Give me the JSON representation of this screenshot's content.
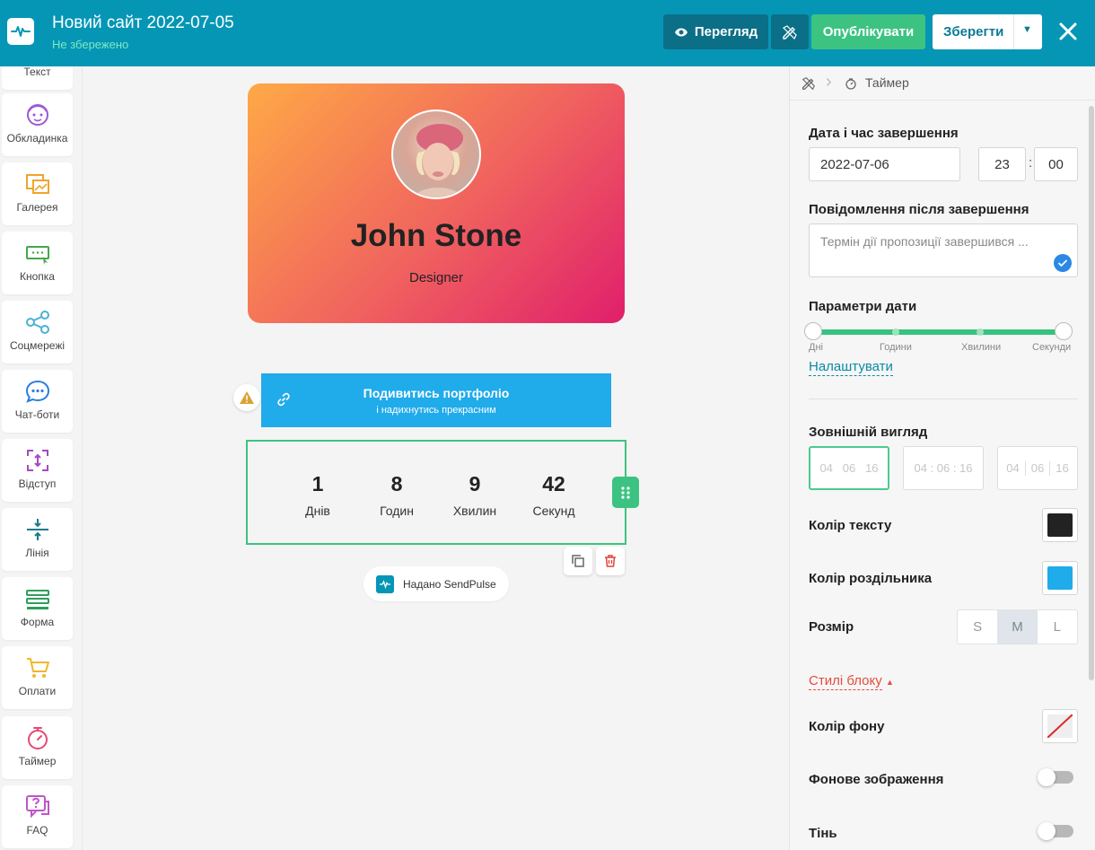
{
  "header": {
    "site_title": "Новий сайт 2022-07-05",
    "status": "Не збережено",
    "preview_label": "Перегляд",
    "publish_label": "Опублікувати",
    "save_label": "Зберегти"
  },
  "sidebar": {
    "items": [
      {
        "label": "Текст",
        "icon": "text-icon"
      },
      {
        "label": "Обкладинка",
        "icon": "cover-icon"
      },
      {
        "label": "Галерея",
        "icon": "gallery-icon"
      },
      {
        "label": "Кнопка",
        "icon": "button-icon"
      },
      {
        "label": "Соцмережі",
        "icon": "share-icon"
      },
      {
        "label": "Чат-боти",
        "icon": "chatbot-icon"
      },
      {
        "label": "Відступ",
        "icon": "spacing-icon"
      },
      {
        "label": "Лінія",
        "icon": "divider-icon"
      },
      {
        "label": "Форма",
        "icon": "form-icon"
      },
      {
        "label": "Оплати",
        "icon": "cart-icon"
      },
      {
        "label": "Таймер",
        "icon": "timer-icon"
      },
      {
        "label": "FAQ",
        "icon": "faq-icon"
      }
    ]
  },
  "canvas": {
    "profile": {
      "name": "John Stone",
      "role": "Designer"
    },
    "portfolio_button": {
      "title": "Подивитись портфоліо",
      "subtitle": "і надихнутись прекрасним"
    },
    "timer": [
      {
        "value": "1",
        "unit": "Днів"
      },
      {
        "value": "8",
        "unit": "Годин"
      },
      {
        "value": "9",
        "unit": "Хвилин"
      },
      {
        "value": "42",
        "unit": "Секунд"
      }
    ],
    "badge": "Надано SendPulse"
  },
  "panel": {
    "breadcrumb": "Таймер",
    "end_label": "Дата і час завершення",
    "end_date": "2022-07-06",
    "end_hour": "23",
    "end_minute": "00",
    "time_separator": ":",
    "message_label": "Повідомлення після завершення",
    "message_placeholder": "Термін дії пропозиції завершився ...",
    "params_label": "Параметри дати",
    "slider_labels": [
      "Дні",
      "Години",
      "Хвилини",
      "Секунди"
    ],
    "configure_link": "Налаштувати",
    "appearance_label": "Зовнішній вигляд",
    "appearance_options": [
      {
        "d": "04",
        "h": "06",
        "m": "16"
      },
      {
        "text": "04 : 06 : 16"
      },
      {
        "d": "04",
        "h": "06",
        "m": "16"
      }
    ],
    "text_color_label": "Колір тексту",
    "text_color": "#222222",
    "separator_color_label": "Колір роздільника",
    "separator_color": "#20abea",
    "size_label": "Розмір",
    "sizes": [
      "S",
      "M",
      "L"
    ],
    "selected_size": "M",
    "block_styles_link": "Стилі блоку",
    "bg_color_label": "Колір фону",
    "bg_image_label": "Фонове зображення",
    "bg_image_enabled": false,
    "shadow_label": "Тінь",
    "shadow_enabled": false
  },
  "colors": {
    "header_bg": "#0596b6",
    "accent_green": "#3dc381",
    "portfolio_button": "#20abea"
  }
}
